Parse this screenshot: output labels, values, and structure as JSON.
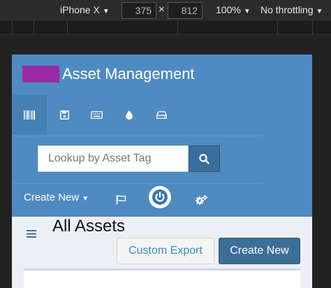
{
  "devtools": {
    "device": "iPhone X",
    "width": "375",
    "times": "×",
    "height": "812",
    "zoom": "100%",
    "throttling": "No throttling"
  },
  "app": {
    "title": "Asset Management",
    "brand_color": "#9a2aa6",
    "accent": "#4f8ac0",
    "top_icons": [
      "barcode-icon",
      "save-icon",
      "keyboard-icon",
      "tint-icon",
      "hdd-icon"
    ],
    "search": {
      "placeholder": "Lookup by Asset Tag",
      "button_icon": "search-icon"
    },
    "nav": {
      "create_new": "Create New",
      "icons": [
        "flag-icon",
        "power-icon",
        "cogs-icon"
      ]
    }
  },
  "main": {
    "page_title": "All Assets",
    "custom_export": "Custom Export",
    "create_new": "Create New"
  }
}
